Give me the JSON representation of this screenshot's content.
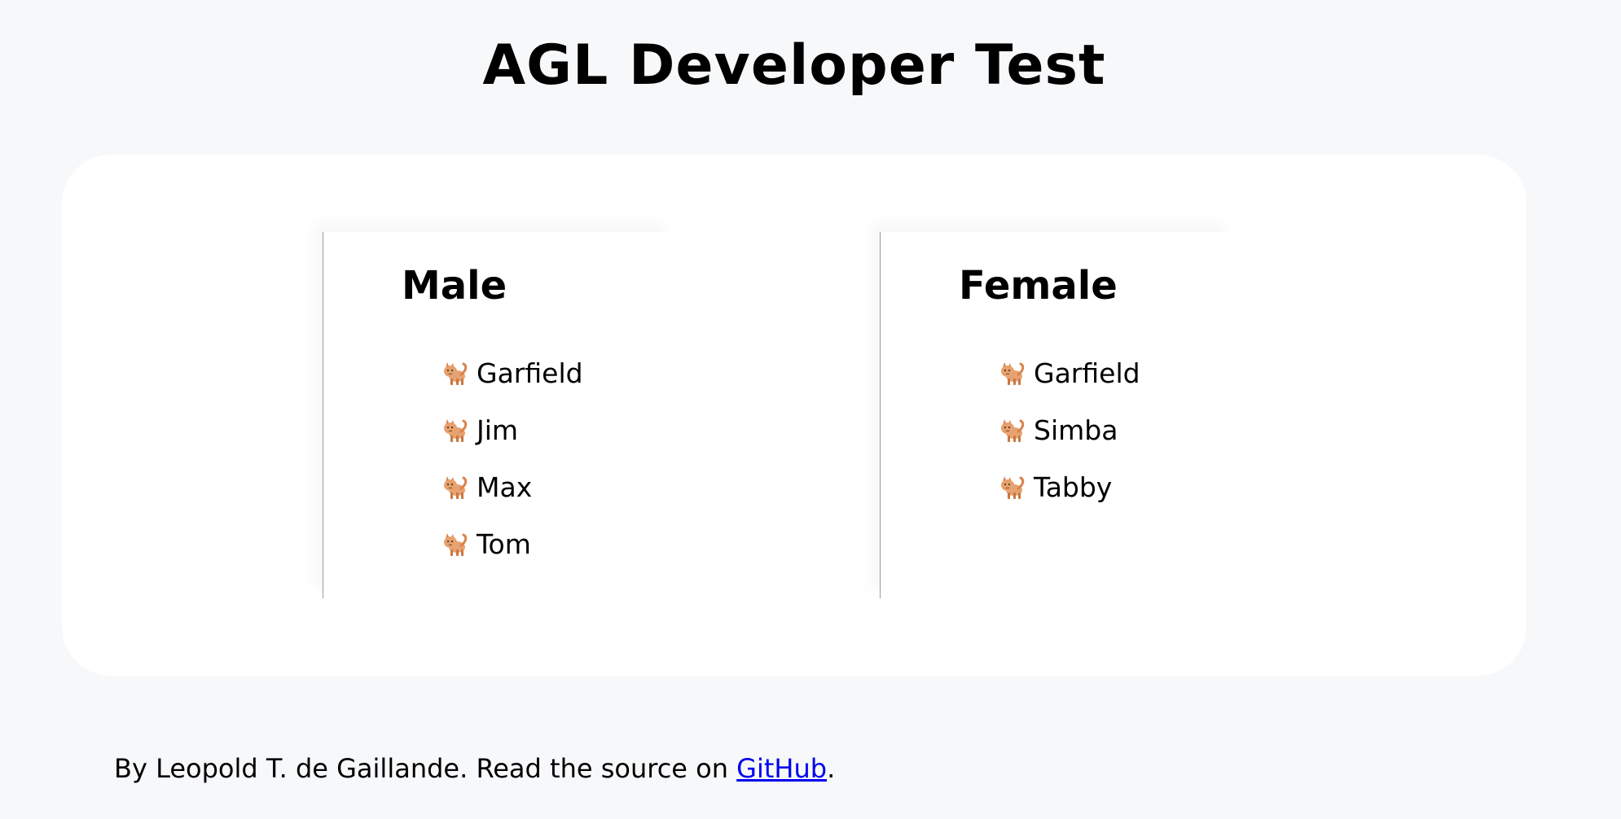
{
  "page": {
    "title": "AGL Developer Test"
  },
  "groups": [
    {
      "title": "Male",
      "items": [
        "Garfield",
        "Jim",
        "Max",
        "Tom"
      ]
    },
    {
      "title": "Female",
      "items": [
        "Garfield",
        "Simba",
        "Tabby"
      ]
    }
  ],
  "footer": {
    "prefix": "By Leopold T. de Gaillande. Read the source on ",
    "link_text": "GitHub",
    "suffix": "."
  },
  "icons": {
    "pet": "cat-icon"
  },
  "colors": {
    "page_background": "#f7f8fa",
    "card_background": "#ffffff",
    "link": "#0000ee",
    "text": "#000000",
    "cat_orange": "#d9834c"
  }
}
